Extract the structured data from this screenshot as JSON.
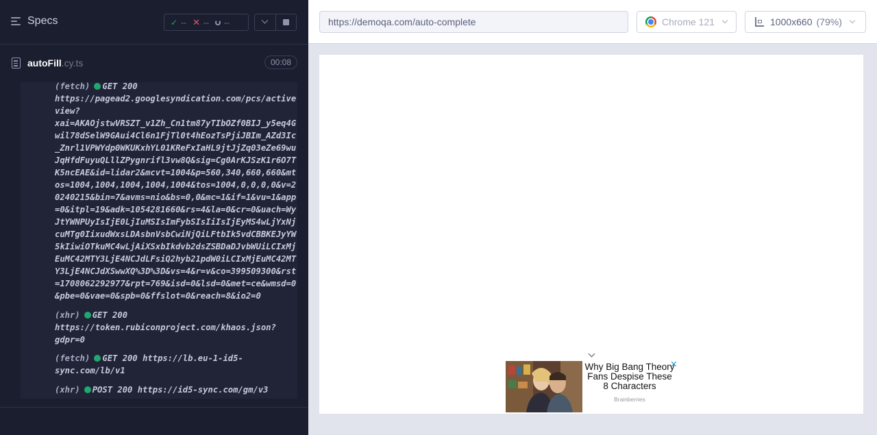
{
  "reporter": {
    "specs_label": "Specs",
    "stats": {
      "passed": "--",
      "failed": "--",
      "pending": "--"
    },
    "file": {
      "name": "autoFill",
      "ext": ".cy.ts",
      "duration": "00:08"
    },
    "log_entries": [
      {
        "kind": "(fetch)",
        "method": "GET 200",
        "url_lines": [
          "",
          "https://pagead2.googlesyndication.com/pcs/active",
          "view?",
          "xai=AKAOjstwVRSZT_v1Zh_Cn1tm87yTIbOZf0BIJ_y5eq4G",
          "wil78dSelW9GAui4Cl6n1FjTl0t4hEozTsPjiJBIm_AZd3Ic",
          "_Znrl1VPWYdp0WKUKxhYL01KReFxIaHL9jtJjZq03eZe69wu",
          "JqHfdFuyuQLllZPygnrifl3vw8Q&sig=Cg0ArKJSzK1r6O7T",
          "K5ncEAE&id=lidar2&mcvt=1004&p=560,340,660,660&mt",
          "os=1004,1004,1004,1004,1004&tos=1004,0,0,0,0&v=2",
          "0240215&bin=7&avms=nio&bs=0,0&mc=1&if=1&vu=1&app",
          "=0&itpl=19&adk=1054281660&rs=4&la=0&cr=0&uach=Wy",
          "JtYWNPUyIsIjE0LjIuMSIsImFybSIsIiIsIjEyMS4wLjYxNj",
          "cuMTg0IixudWxsLDAsbnVsbCwiNjQiLFtbIk5vdCBBKEJyYW",
          "5kIiwiOTkuMC4wLjAiXSxbIkdvb2dsZSBDaDJvbWUiLCIxMj",
          "EuMC42MTY3LjE4NCJdLFsiQ2hyb21pdW0iLCIxMjEuMC42MT",
          "Y3LjE4NCJdXSwwXQ%3D%3D&vs=4&r=v&co=399509300&rst",
          "=1708062292977&rpt=769&isd=0&lsd=0&met=ce&wmsd=0",
          "&pbe=0&vae=0&spb=0&ffslot=0&reach=8&io2=0"
        ]
      },
      {
        "kind": "(xhr)",
        "method": "GET 200",
        "url_lines": [
          "",
          "https://token.rubiconproject.com/khaos.json?",
          "gdpr=0"
        ]
      },
      {
        "kind": "(fetch)",
        "method": "GET 200 https://lb.eu-1-id5-",
        "url_lines": [
          "sync.com/lb/v1"
        ]
      },
      {
        "kind": "(xhr)",
        "method": "POST 200 https://id5-sync.com/gm/v3",
        "url_lines": []
      }
    ]
  },
  "aut": {
    "url": "https://demoqa.com/auto-complete",
    "browser": "Chrome 121",
    "viewport": "1000x660",
    "viewport_scale": "(79%)",
    "ad": {
      "title": "Why Big Bang Theory Fans Despise These 8 Characters",
      "source": "Brainberries",
      "close_glyph": "✕"
    }
  },
  "colors": {
    "pass": "#1fa971",
    "fail": "#e45770",
    "panel_bg": "#1b1e2e",
    "aut_bg": "#e1e3ed"
  }
}
